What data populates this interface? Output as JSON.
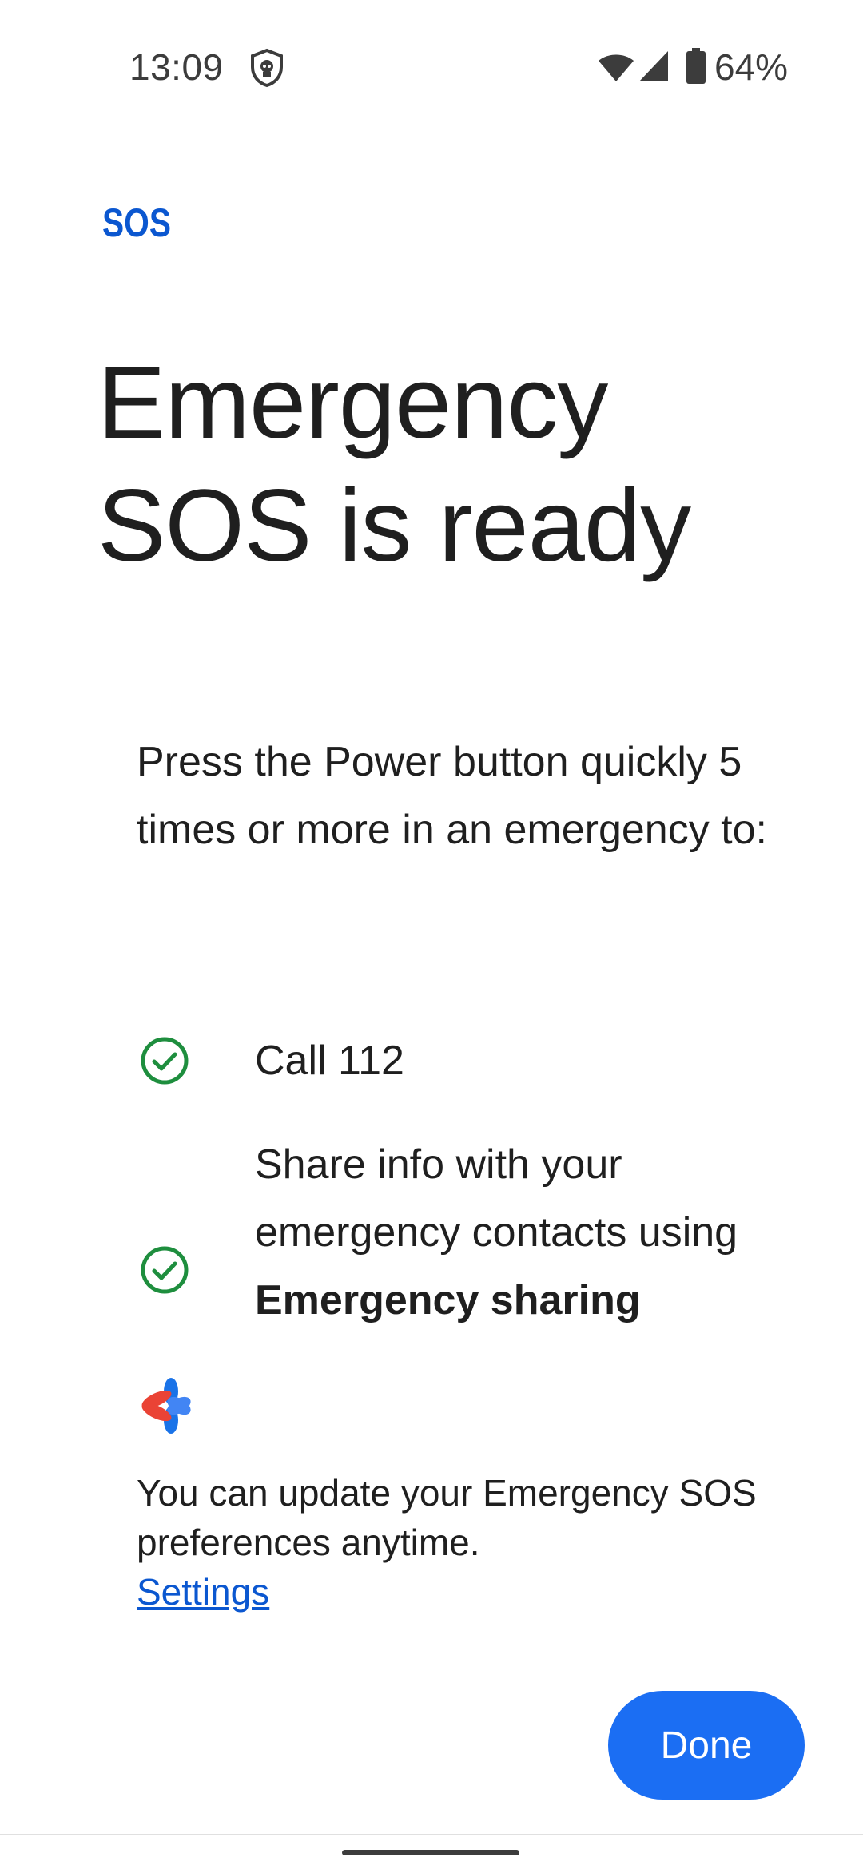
{
  "status_bar": {
    "time": "13:09",
    "battery": "64%",
    "icons": [
      "shield-icon",
      "wifi-icon",
      "signal-icon",
      "battery-icon"
    ]
  },
  "header": {
    "logo_text": "SOS",
    "title": "Emergency SOS is ready"
  },
  "intro": "Press the Power button quickly 5 times or more in an emergency to:",
  "features": [
    {
      "icon": "check-circle-icon",
      "text": "Call 112"
    },
    {
      "icon": "check-circle-icon",
      "text_prefix": "Share info with your emergency contacts using",
      "text_bold": "Emergency sharing"
    }
  ],
  "footer": {
    "note": "You can update your Emergency SOS preferences anytime.",
    "settings_link": "Settings"
  },
  "actions": {
    "done_label": "Done"
  },
  "colors": {
    "accent": "#1b6ef3",
    "link": "#0b57d0",
    "check": "#1e8e3e",
    "logo": "#0b57d0"
  }
}
